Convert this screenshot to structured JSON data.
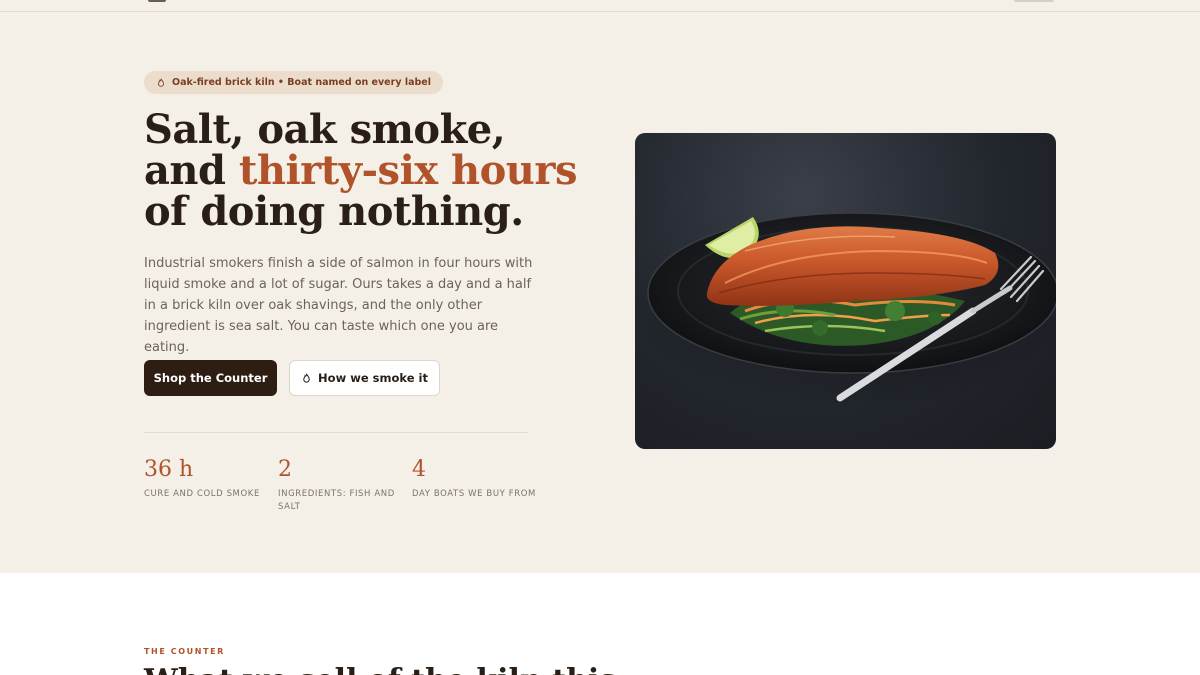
{
  "hero": {
    "eyebrow": "Oak-fired brick kiln • Boat named on every label",
    "headline": {
      "line1": "Salt, oak smoke,",
      "line2_prefix": "and ",
      "line2_accent": "thirty-six hours",
      "line3": "of doing nothing."
    },
    "lede": "Industrial smokers finish a side of salmon in four hours with liquid smoke and a lot of sugar. Ours takes a day and a half in a brick kiln over oak shavings, and the only other ingredient is sea salt. You can taste which one you are eating.",
    "primary_cta": "Shop the Counter",
    "secondary_cta": "How we smoke it",
    "stats": [
      {
        "value": "36 h",
        "label": "CURE AND COLD SMOKE"
      },
      {
        "value": "2",
        "label": "INGREDIENTS: FISH AND SALT"
      },
      {
        "value": "4",
        "label": "DAY BOATS WE BUY FROM"
      }
    ]
  },
  "section2": {
    "kicker": "THE COUNTER",
    "title": "What we sell of the kiln this"
  },
  "icons": {
    "eyebrow_icon": "flame-icon",
    "secondary_cta_icon": "flame-icon"
  },
  "colors": {
    "accent": "#b0532a",
    "dark": "#2d1d12",
    "background": "#f4f0e8"
  }
}
